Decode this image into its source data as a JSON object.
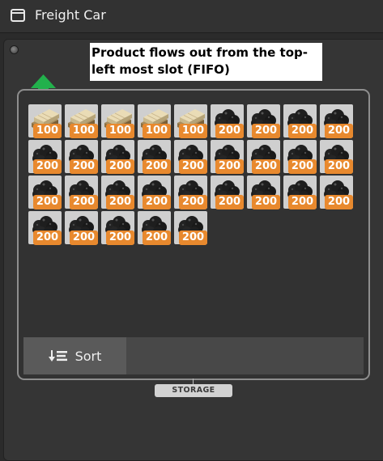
{
  "window": {
    "title": "Freight Car"
  },
  "note": {
    "text": "Product flows out from the top-left most slot (FIFO)"
  },
  "slots": [
    {
      "item": "planks",
      "count": "100"
    },
    {
      "item": "planks",
      "count": "100"
    },
    {
      "item": "planks",
      "count": "100"
    },
    {
      "item": "planks",
      "count": "100"
    },
    {
      "item": "planks",
      "count": "100"
    },
    {
      "item": "coal",
      "count": "200"
    },
    {
      "item": "coal",
      "count": "200"
    },
    {
      "item": "coal",
      "count": "200"
    },
    {
      "item": "coal",
      "count": "200"
    },
    {
      "item": "coal",
      "count": "200"
    },
    {
      "item": "coal",
      "count": "200"
    },
    {
      "item": "coal",
      "count": "200"
    },
    {
      "item": "coal",
      "count": "200"
    },
    {
      "item": "coal",
      "count": "200"
    },
    {
      "item": "coal",
      "count": "200"
    },
    {
      "item": "coal",
      "count": "200"
    },
    {
      "item": "coal",
      "count": "200"
    },
    {
      "item": "coal",
      "count": "200"
    },
    {
      "item": "coal",
      "count": "200"
    },
    {
      "item": "coal",
      "count": "200"
    },
    {
      "item": "coal",
      "count": "200"
    },
    {
      "item": "coal",
      "count": "200"
    },
    {
      "item": "coal",
      "count": "200"
    },
    {
      "item": "coal",
      "count": "200"
    },
    {
      "item": "coal",
      "count": "200"
    },
    {
      "item": "coal",
      "count": "200"
    },
    {
      "item": "coal",
      "count": "200"
    },
    {
      "item": "coal",
      "count": "200"
    },
    {
      "item": "coal",
      "count": "200"
    },
    {
      "item": "coal",
      "count": "200"
    },
    {
      "item": "coal",
      "count": "200"
    },
    {
      "item": "coal",
      "count": "200"
    }
  ],
  "toolbar": {
    "sort_label": "Sort"
  },
  "panel": {
    "storage_label": "STORAGE"
  },
  "colors": {
    "badge": "#e8892e",
    "arrow": "#22b14c",
    "slot": "#cfcfcf"
  }
}
